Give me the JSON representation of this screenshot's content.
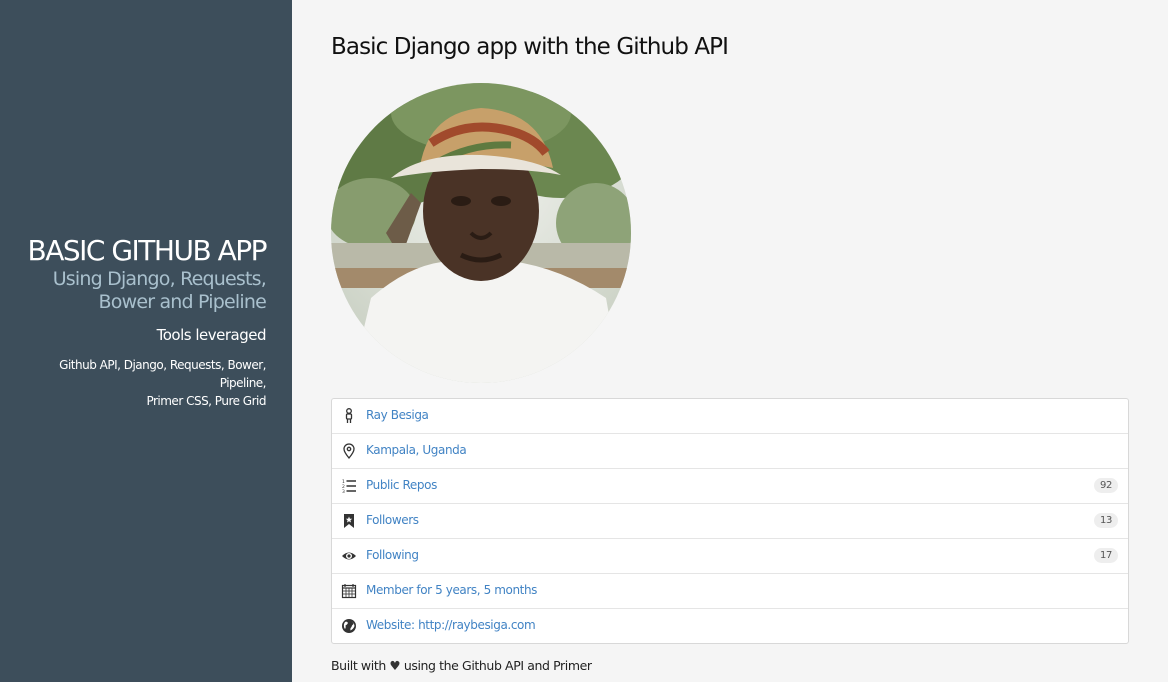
{
  "sidebar": {
    "title": "BASIC GITHUB APP",
    "subtitle_line1": "Using Django, Requests,",
    "subtitle_line2": "Bower and Pipeline",
    "tools_heading": "Tools leveraged",
    "tools_line1": "Github API, Django, Requests, Bower, Pipeline,",
    "tools_line2": "Primer CSS, Pure Grid"
  },
  "main": {
    "title": "Basic Django app with the Github API",
    "profile": [
      {
        "icon": "person-icon",
        "label": "Ray Besiga"
      },
      {
        "icon": "location-icon",
        "label": "Kampala, Uganda"
      },
      {
        "icon": "repo-list-icon",
        "label": "Public Repos",
        "count": "92"
      },
      {
        "icon": "bookmark-icon",
        "label": "Followers",
        "count": "13"
      },
      {
        "icon": "eye-icon",
        "label": "Following",
        "count": "17"
      },
      {
        "icon": "calendar-icon",
        "label": "Member for 5 years, 5 months"
      },
      {
        "icon": "globe-icon",
        "label": "Website: http://raybesiga.com"
      }
    ]
  },
  "footer": {
    "prefix": "Built with",
    "heart": "♥",
    "suffix": "using the Github API and Primer"
  },
  "colors": {
    "sidebar_bg": "#3d4e5b",
    "subtitle": "#a9c0cd",
    "link": "#4183c4",
    "page_bg": "#f5f5f5"
  }
}
